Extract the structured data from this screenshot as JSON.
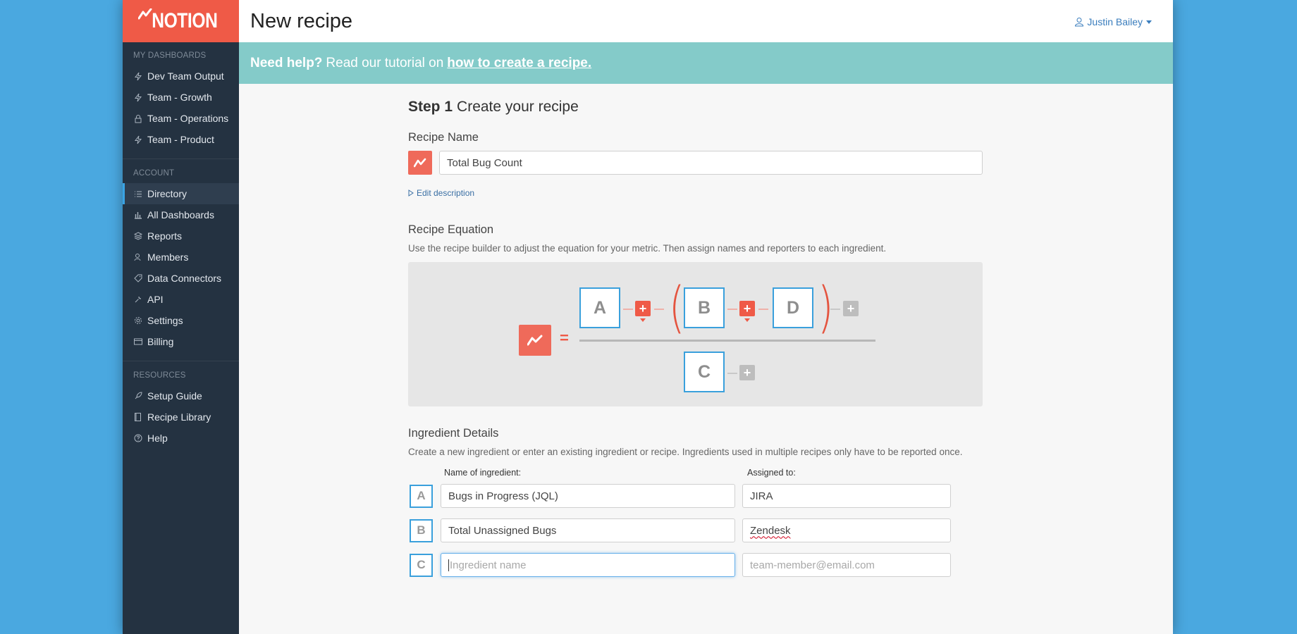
{
  "brand": {
    "name": "NOTION"
  },
  "sidebar": {
    "sections": [
      {
        "label": "MY DASHBOARDS",
        "items": [
          {
            "label": "Dev Team Output",
            "icon": "bolt-icon"
          },
          {
            "label": "Team - Growth",
            "icon": "bolt-icon"
          },
          {
            "label": "Team - Operations",
            "icon": "lock-icon"
          },
          {
            "label": "Team - Product",
            "icon": "bolt-icon"
          }
        ]
      },
      {
        "label": "ACCOUNT",
        "items": [
          {
            "label": "Directory",
            "icon": "list-icon",
            "active": true
          },
          {
            "label": "All Dashboards",
            "icon": "bar-chart-icon"
          },
          {
            "label": "Reports",
            "icon": "layers-icon"
          },
          {
            "label": "Members",
            "icon": "users-icon"
          },
          {
            "label": "Data Connectors",
            "icon": "tag-icon"
          },
          {
            "label": "API",
            "icon": "wrench-icon"
          },
          {
            "label": "Settings",
            "icon": "gear-icon"
          },
          {
            "label": "Billing",
            "icon": "credit-card-icon"
          }
        ]
      },
      {
        "label": "RESOURCES",
        "items": [
          {
            "label": "Setup Guide",
            "icon": "rocket-icon"
          },
          {
            "label": "Recipe Library",
            "icon": "book-icon"
          },
          {
            "label": "Help",
            "icon": "question-icon"
          }
        ]
      }
    ]
  },
  "header": {
    "title": "New recipe",
    "user": "Justin Bailey"
  },
  "help_bar": {
    "lead": "Need help?",
    "text": "Read our tutorial on",
    "link": "how to create a recipe."
  },
  "step": {
    "number": "Step 1",
    "title": "Create your recipe"
  },
  "recipe_name": {
    "label": "Recipe Name",
    "value": "Total Bug Count",
    "edit_description": "Edit description"
  },
  "equation": {
    "label": "Recipe Equation",
    "description": "Use the recipe builder to adjust the equation for your metric. Then assign names and reporters to each ingredient.",
    "equals": "=",
    "open_paren": "(",
    "close_paren": ")",
    "plus": "+",
    "numerator": [
      "A",
      "B",
      "D"
    ],
    "denominator": [
      "C"
    ]
  },
  "ingredients": {
    "label": "Ingredient Details",
    "description": "Create a new ingredient or enter an existing ingredient or recipe. Ingredients used in multiple recipes only have to be reported once.",
    "col_name": "Name of ingredient:",
    "col_assigned": "Assigned to:",
    "rows": [
      {
        "letter": "A",
        "name": "Bugs in Progress (JQL)",
        "assigned": "JIRA"
      },
      {
        "letter": "B",
        "name": "Total Unassigned Bugs",
        "assigned": "Zendesk"
      },
      {
        "letter": "C",
        "name": "",
        "name_placeholder": "Ingredient name",
        "assigned": "",
        "assigned_placeholder": "team-member@email.com"
      }
    ]
  },
  "colors": {
    "brand": "#ef5a47",
    "sidebar": "#243241",
    "help_bar": "#84cbc9",
    "ingredient_border": "#3aa0dc",
    "link": "#3a7dbd"
  }
}
